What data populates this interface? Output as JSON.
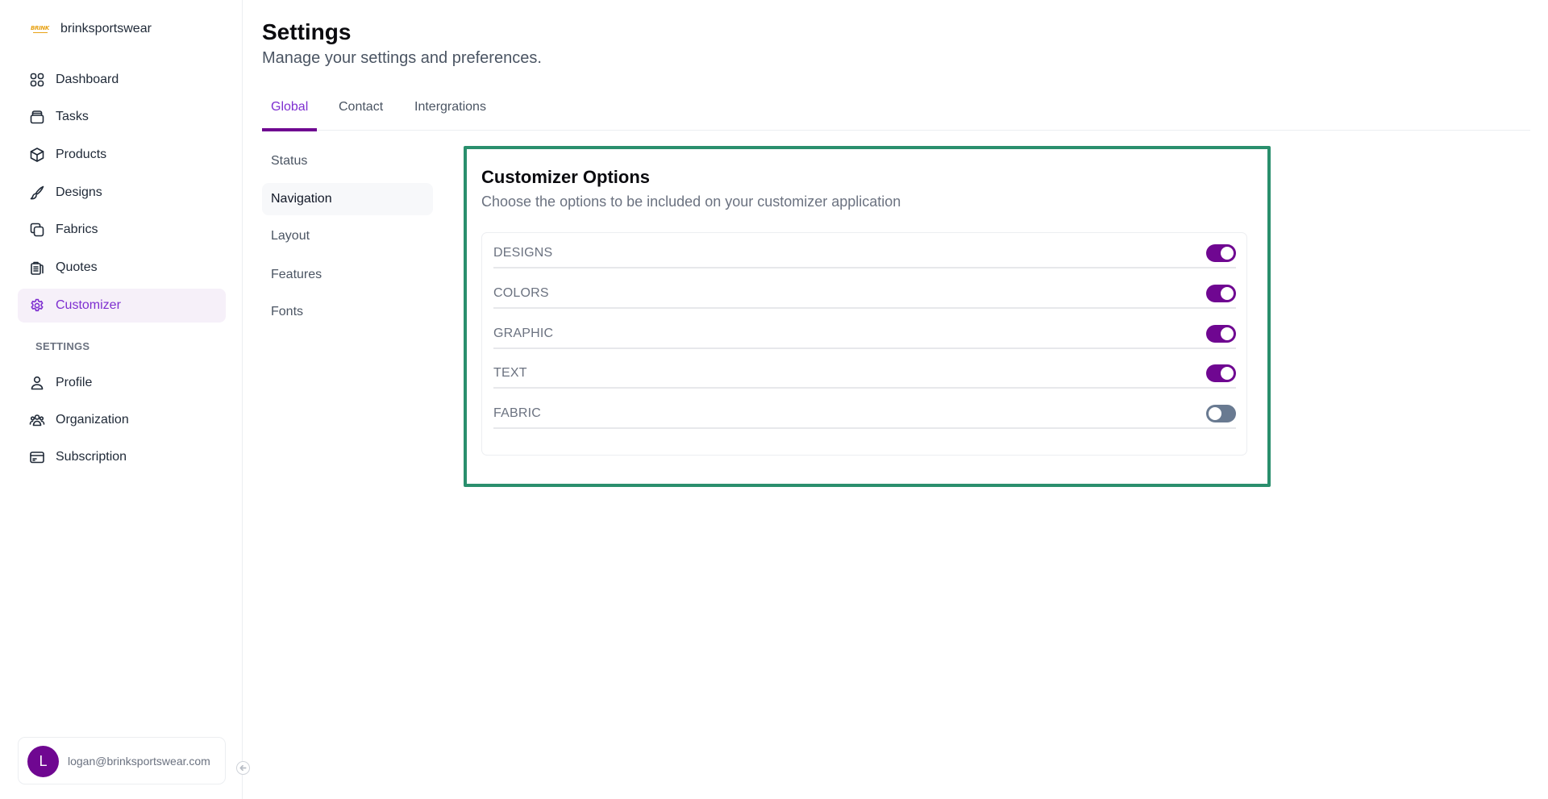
{
  "brand": {
    "name": "brinksportswear",
    "logo_text": "BRINK",
    "logo_color": "#e8a317"
  },
  "sidebar": {
    "items": [
      {
        "label": "Dashboard",
        "icon": "dashboard-grid-icon",
        "active": false
      },
      {
        "label": "Tasks",
        "icon": "tasks-stack-icon",
        "active": false
      },
      {
        "label": "Products",
        "icon": "products-box-icon",
        "active": false
      },
      {
        "label": "Designs",
        "icon": "designs-brush-icon",
        "active": false
      },
      {
        "label": "Fabrics",
        "icon": "fabrics-copy-icon",
        "active": false
      },
      {
        "label": "Quotes",
        "icon": "quotes-clipboard-icon",
        "active": false
      },
      {
        "label": "Customizer",
        "icon": "customizer-gear-icon",
        "active": true
      }
    ],
    "section_label": "SETTINGS",
    "settings_items": [
      {
        "label": "Profile",
        "icon": "profile-user-icon"
      },
      {
        "label": "Organization",
        "icon": "organization-users-icon"
      },
      {
        "label": "Subscription",
        "icon": "subscription-card-icon"
      }
    ],
    "user": {
      "initial": "L",
      "email": "logan@brinksportswear.com",
      "avatar_color": "#6f0791"
    }
  },
  "header": {
    "title": "Settings",
    "subtitle": "Manage your settings and preferences."
  },
  "tabs": [
    {
      "label": "Global",
      "active": true
    },
    {
      "label": "Contact",
      "active": false
    },
    {
      "label": "Intergrations",
      "active": false
    }
  ],
  "subnav": [
    {
      "label": "Status",
      "active": false
    },
    {
      "label": "Navigation",
      "active": true
    },
    {
      "label": "Layout",
      "active": false
    },
    {
      "label": "Features",
      "active": false
    },
    {
      "label": "Fonts",
      "active": false
    }
  ],
  "customizer": {
    "title": "Customizer Options",
    "subtitle": "Choose the options to be included on your customizer application",
    "options": [
      {
        "label": "DESIGNS",
        "enabled": true
      },
      {
        "label": "COLORS",
        "enabled": true
      },
      {
        "label": "GRAPHIC",
        "enabled": true
      },
      {
        "label": "TEXT",
        "enabled": true
      },
      {
        "label": "FABRIC",
        "enabled": false
      }
    ]
  },
  "colors": {
    "accent": "#6f0791",
    "accent_text": "#7e2fd0",
    "highlight_border": "#2a8f6d",
    "toggle_off": "#697a91"
  }
}
